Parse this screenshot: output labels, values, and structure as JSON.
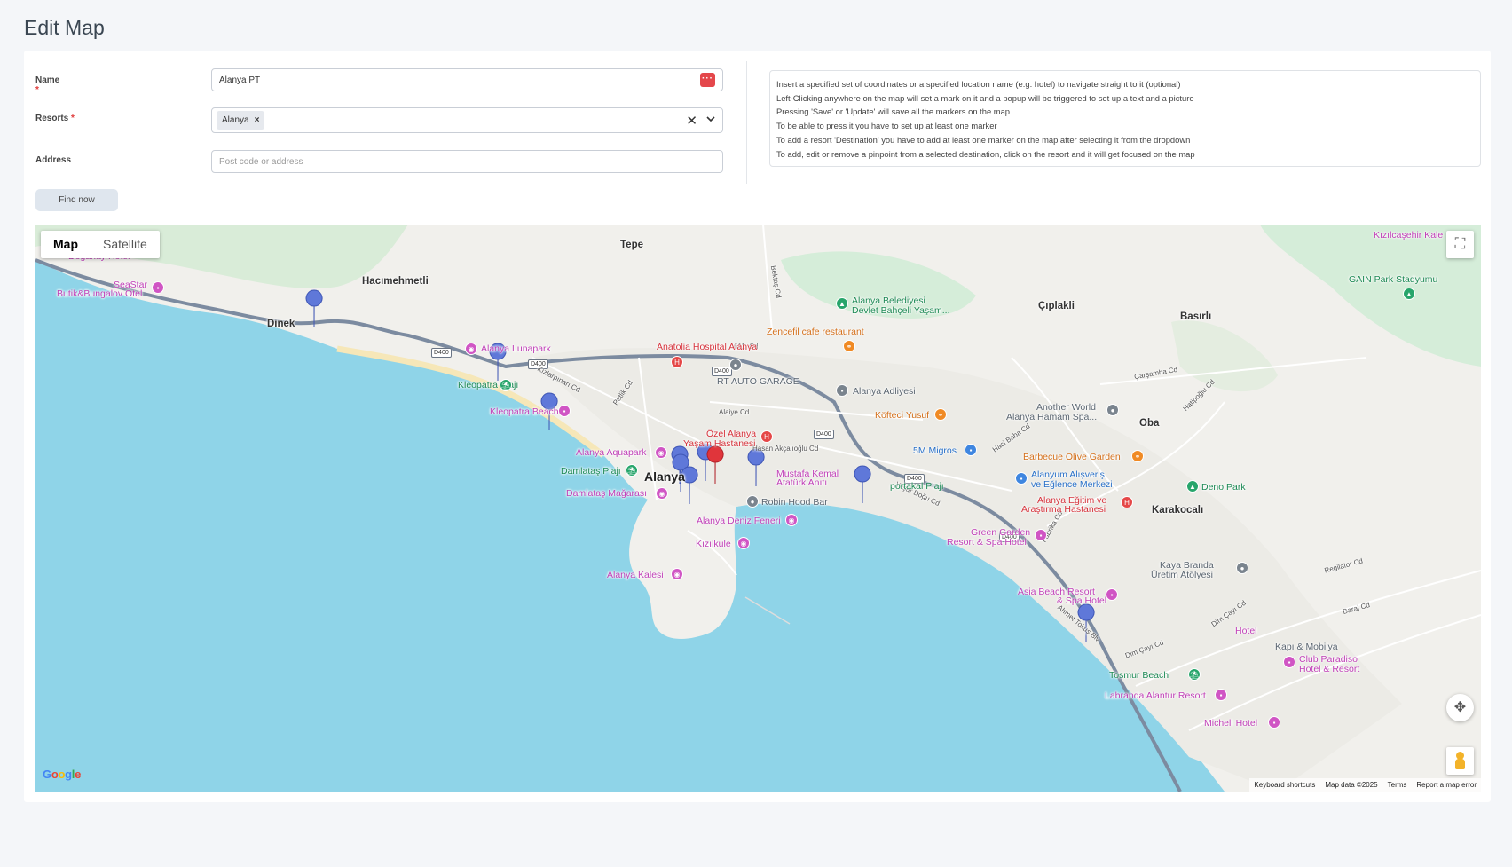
{
  "page": {
    "title": "Edit Map"
  },
  "form": {
    "name_label": "Name",
    "name_value": "Alanya PT",
    "resorts_label": "Resorts",
    "resorts_selected": "Alanya",
    "resorts_chip_remove": "×",
    "clear_icon": "✕",
    "dropdown_icon": "⌄",
    "required_mark": "*",
    "address_label": "Address",
    "address_placeholder": "Post code or address",
    "find_button": "Find now"
  },
  "help": [
    "Insert a specified set of coordinates or a specified location name (e.g. hotel) to navigate straight to it (optional)",
    "Left-Clicking anywhere on the map will set a mark on it and a popup will be triggered to set up a text and a picture",
    "Pressing 'Save' or 'Update' will save all the markers on the map.",
    "To be able to press it you have to set up at least one marker",
    "To add a resort 'Destination' you have to add at least one marker on the map after selecting it from the dropdown",
    "To add, edit or remove a pinpoint from a selected destination, click on the resort and it will get focused on the map"
  ],
  "map": {
    "type_map": "Map",
    "type_satellite": "Satellite",
    "fullscreen_icon": "⛶",
    "camera_icon": "✥",
    "logo": [
      "G",
      "o",
      "o",
      "g",
      "l",
      "e"
    ],
    "attrib_shortcuts": "Keyboard shortcuts",
    "attrib_data": "Map data ©2025",
    "attrib_terms": "Terms",
    "attrib_report": "Report a map error",
    "colors": {
      "water": "#8fd4e8",
      "land": "#f1f0ec",
      "park": "#cfead5",
      "road": "#7c8ba0",
      "marker": "#5f78d9",
      "marker_red": "#e0353b"
    },
    "places": [
      "Tepe",
      "Hacımehmetli",
      "Dinek",
      "Çıplakli",
      "Basırlı",
      "Oba",
      "Karakocalı",
      "Alanya"
    ],
    "road_labels": [
      "D400",
      "D400",
      "D400",
      "D400",
      "D400",
      "D400",
      "Kızlarpınarı Cd",
      "Petlik Cd",
      "Alaiye Cd",
      "611. Cd",
      "Hasan Akçalıoğlu Cd",
      "Yaşar Doğu Cd",
      "Fabrika Cd",
      "Ahmet Tokuş Blv",
      "Dim Çayı Cd",
      "Dim Çayı Cd",
      "Regilator Cd",
      "Baraj Cd",
      "Çarşamba Cd",
      "Hatipoğlu Cd",
      "Haci Baba Cd",
      "Bektaş Cd"
    ],
    "pois": [
      {
        "t": "Doğanay Hotel",
        "c": "pink"
      },
      {
        "t": "SeaStar",
        "c": "pink"
      },
      {
        "t": "Butik&Bungalov Otel",
        "c": "pink"
      },
      {
        "t": "Alanya Lunapark",
        "c": "pink"
      },
      {
        "t": "Kleopatra Plajı",
        "c": "green"
      },
      {
        "t": "Kleopatra Beach",
        "c": "pink"
      },
      {
        "t": "Alanya Aquapark",
        "c": "pink"
      },
      {
        "t": "Damlataş Plajı",
        "c": "green"
      },
      {
        "t": "Damlataş Mağarası",
        "c": "pink"
      },
      {
        "t": "Anatolia Hospital Alanya",
        "c": "red"
      },
      {
        "t": "RT AUTO GARAGE",
        "c": "gray"
      },
      {
        "t": "Özel Alanya",
        "c": "red"
      },
      {
        "t": "Yaşam Hastanesi",
        "c": "red"
      },
      {
        "t": "Mustafa Kemal",
        "c": "pink"
      },
      {
        "t": "Atatürk Anıtı",
        "c": "pink"
      },
      {
        "t": "Robin Hood Bar",
        "c": "gray"
      },
      {
        "t": "Alanya Deniz Feneri",
        "c": "pink"
      },
      {
        "t": "Kızılkule",
        "c": "pink"
      },
      {
        "t": "Alanya Kalesi",
        "c": "pink"
      },
      {
        "t": "Alanya Belediyesi",
        "c": "green"
      },
      {
        "t": "Devlet Bahçeli Yaşam...",
        "c": "green"
      },
      {
        "t": "Zencefil cafe restaurant",
        "c": "orange"
      },
      {
        "t": "Alanya Adliyesi",
        "c": "gray"
      },
      {
        "t": "Köfteci Yusuf",
        "c": "orange"
      },
      {
        "t": "5M Migros",
        "c": "blue"
      },
      {
        "t": "portakal Plajı",
        "c": "green"
      },
      {
        "t": "Another World",
        "c": "gray"
      },
      {
        "t": "Alanya Hamam Spa...",
        "c": "gray"
      },
      {
        "t": "Barbecue Olive Garden",
        "c": "orange"
      },
      {
        "t": "Alanyum Alışveriş",
        "c": "blue"
      },
      {
        "t": "ve Eğlence Merkezi",
        "c": "blue"
      },
      {
        "t": "Alanya Eğitim ve",
        "c": "red"
      },
      {
        "t": "Araştırma Hastanesi",
        "c": "red"
      },
      {
        "t": "Deno Park",
        "c": "green"
      },
      {
        "t": "Green Garden",
        "c": "pink"
      },
      {
        "t": "Resort & Spa Hotel",
        "c": "pink"
      },
      {
        "t": "Kaya Branda",
        "c": "gray"
      },
      {
        "t": "Üretim Atölyesi",
        "c": "gray"
      },
      {
        "t": "Asia Beach Resort",
        "c": "pink"
      },
      {
        "t": "& Spa Hotel",
        "c": "pink"
      },
      {
        "t": "Hotel",
        "c": "pink"
      },
      {
        "t": "Kapı & Mobilya",
        "c": "gray"
      },
      {
        "t": "Club Paradiso",
        "c": "pink"
      },
      {
        "t": "Hotel & Resort",
        "c": "pink"
      },
      {
        "t": "Tosmur Beach",
        "c": "green"
      },
      {
        "t": "Labranda Alantur Resort",
        "c": "pink"
      },
      {
        "t": "Michell Hotel",
        "c": "pink"
      },
      {
        "t": "Kızılcaşehir Kale",
        "c": "pink"
      },
      {
        "t": "GAIN Park Stadyumu",
        "c": "green"
      }
    ]
  }
}
